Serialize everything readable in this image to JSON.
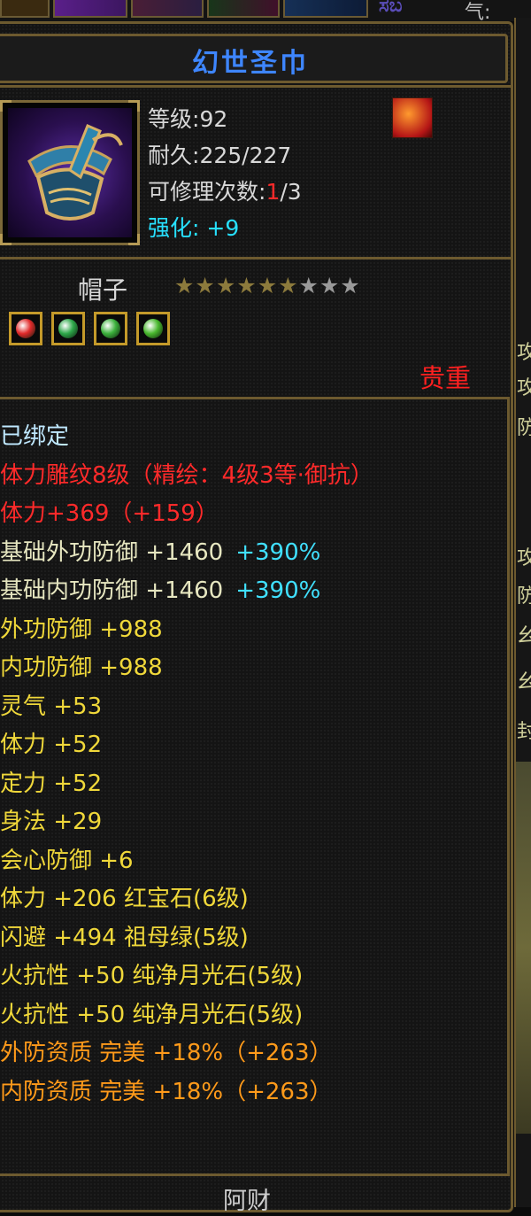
{
  "top": {
    "partial_name": "ಸಬ",
    "qi_label": "气:"
  },
  "item": {
    "title": "幻世圣巾",
    "level_label": "等级:",
    "level_value": "92",
    "durability_label": "耐久:",
    "durability_value": "225/227",
    "repair_label": "可修理次数:",
    "repair_used": "1",
    "repair_total": "/3",
    "enhance_label": "强化:",
    "enhance_value": "+9",
    "type": "帽子",
    "stars_lit": 6,
    "stars_total": 9,
    "rarity": "贵重",
    "footer_name": "阿财"
  },
  "gems": [
    {
      "name": "red-gem-icon",
      "color": "#e02a2a"
    },
    {
      "name": "green-gem-icon",
      "color": "#2ea84a"
    },
    {
      "name": "green-gem-icon",
      "color": "#3cb13c"
    },
    {
      "name": "green-gem-icon",
      "color": "#49b82e"
    }
  ],
  "stats": [
    {
      "text": "已绑定",
      "color": "#bfe8ff"
    },
    {
      "text": "体力雕纹8级（精绘：4级3等·御抗）",
      "color": "#ff2a2a"
    },
    {
      "text": "体力+369（+159）",
      "color": "#ff2a2a"
    },
    {
      "text": "基础外功防御 +1460",
      "extra": "+390%",
      "color": "#e6e6c0",
      "extra_color": "#40e0ff"
    },
    {
      "text": "基础内功防御 +1460",
      "extra": "+390%",
      "color": "#e6e6c0",
      "extra_color": "#40e0ff"
    },
    {
      "text": "外功防御 +988",
      "color": "#f0d83a"
    },
    {
      "text": "内功防御 +988",
      "color": "#f0d83a"
    },
    {
      "text": "灵气 +53",
      "color": "#f0d83a"
    },
    {
      "text": "体力 +52",
      "color": "#f0d83a"
    },
    {
      "text": "定力 +52",
      "color": "#f0d83a"
    },
    {
      "text": "身法 +29",
      "color": "#f0d83a"
    },
    {
      "text": "会心防御 +6",
      "color": "#f0d83a"
    },
    {
      "text": "体力 +206 红宝石(6级)",
      "color": "#f0d83a"
    },
    {
      "text": "闪避 +494 祖母绿(5级)",
      "color": "#f0d83a"
    },
    {
      "text": "火抗性 +50 纯净月光石(5级)",
      "color": "#f0d83a"
    },
    {
      "text": "火抗性 +50 纯净月光石(5级)",
      "color": "#f0d83a"
    },
    {
      "text": "外防资质  完美 +18%（+263）",
      "color": "#ff9a1a"
    },
    {
      "text": "内防资质  完美 +18%（+263）",
      "color": "#ff9a1a"
    }
  ],
  "right_edge": [
    "攻",
    "攻",
    "防",
    "攻",
    "防",
    "幺",
    "幺",
    "封"
  ],
  "colors": {
    "frame": "#6d5a2f",
    "title": "#3e86ff",
    "enhance": "#27e0ff",
    "repair_used": "#ff2a2a",
    "star_lit": "#8c7a3c",
    "star_dim": "#9a9a9a"
  }
}
